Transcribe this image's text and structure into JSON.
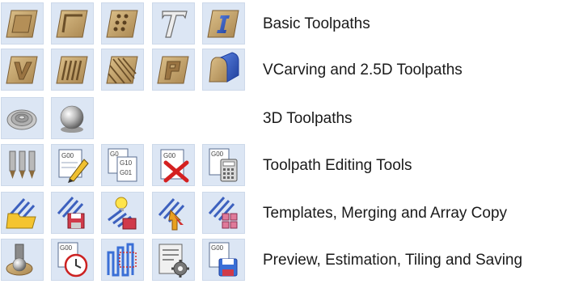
{
  "groups": [
    {
      "label": "Basic Toolpaths",
      "icons": [
        "profile-toolpath-icon",
        "pocket-toolpath-icon",
        "drilling-toolpath-icon",
        "quick-engrave-toolpath-icon",
        "inlay-toolpath-icon"
      ]
    },
    {
      "label": "VCarving and 2.5D Toolpaths",
      "icons": [
        "vcarve-toolpath-icon",
        "fluting-toolpath-icon",
        "texture-toolpath-icon",
        "prism-carving-toolpath-icon",
        "moulding-toolpath-icon"
      ]
    },
    {
      "label": "3D Toolpaths",
      "icons": [
        "3d-roughing-toolpath-icon",
        "3d-finishing-toolpath-icon"
      ]
    },
    {
      "label": "Toolpath Editing Tools",
      "icons": [
        "edit-toolpath-icon",
        "merge-gcode-icon",
        "gcode-tool-icon",
        "delete-gcode-icon",
        "calculator-gcode-icon"
      ]
    },
    {
      "label": "Templates, Merging and Array Copy",
      "icons": [
        "open-template-icon",
        "save-template-icon",
        "merge-toolpaths-icon",
        "array-copy-toolpaths-icon",
        "toolpath-grid-icon"
      ]
    },
    {
      "label": "Preview, Estimation, Tiling and Saving",
      "icons": [
        "preview-toolpaths-icon",
        "machining-time-icon",
        "tiling-toolpath-icon",
        "toolpath-settings-icon",
        "save-toolpaths-icon"
      ]
    }
  ],
  "colors": {
    "tile_bg": "#dce6f4",
    "label_text": "#1a1a1a",
    "wood": "#c9a870",
    "wood_dark": "#8a6a3c"
  }
}
